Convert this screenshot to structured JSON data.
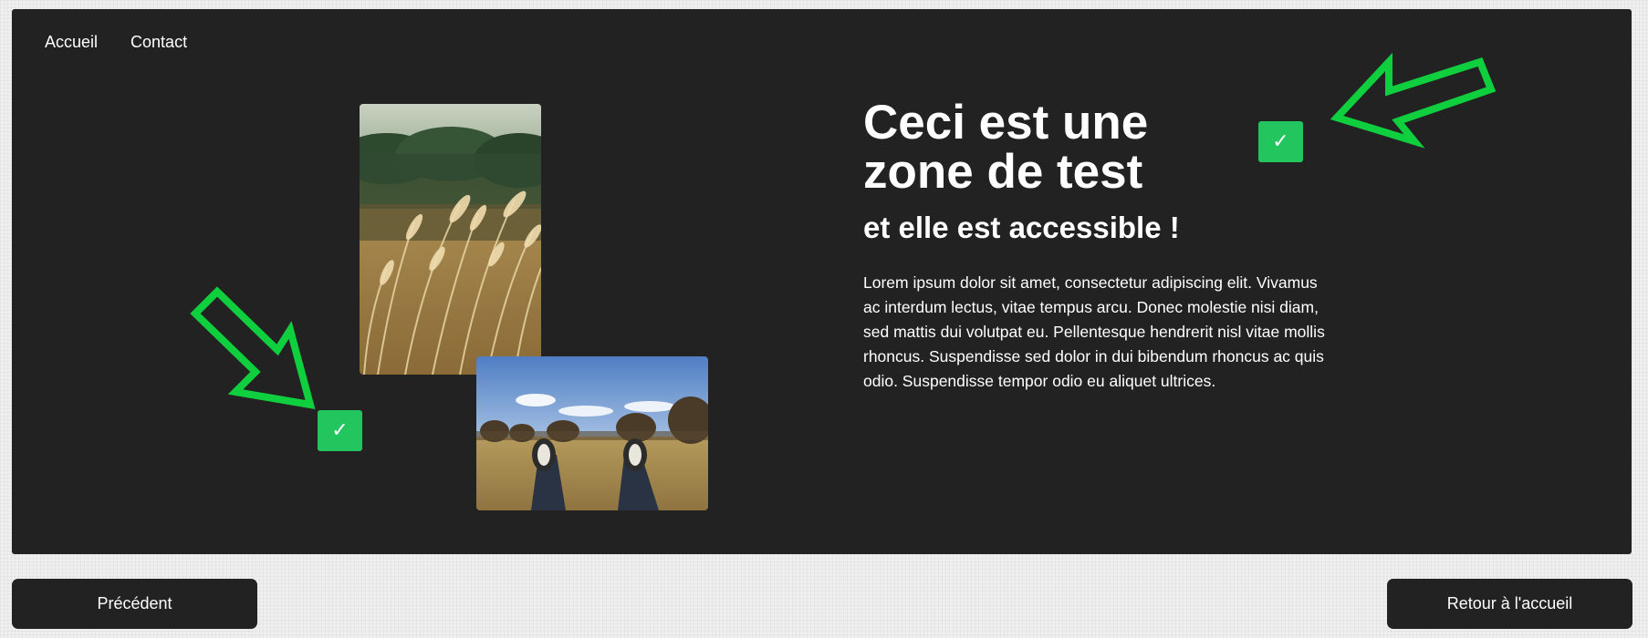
{
  "nav": {
    "items": [
      {
        "label": "Accueil"
      },
      {
        "label": "Contact"
      }
    ]
  },
  "hero": {
    "title": "Ceci est une zone de test",
    "subtitle": "et elle est accessible !",
    "body": "Lorem ipsum dolor sit amet, consectetur adipiscing elit. Vivamus ac interdum lectus, vitae tempus arcu. Donec molestie nisi diam, sed mattis dui volutpat eu. Pellentesque hendrerit nisl vitae mollis rhoncus. Suspendisse sed dolor in dui bibendum rhoncus ac quis odio. Suspendisse tempor odio eu aliquet ultrices."
  },
  "badges": {
    "check_symbol": "✓"
  },
  "icons": {
    "arrow_top": "arrow-pointing-left-icon",
    "arrow_bottom": "arrow-pointing-down-right-icon",
    "check": "checkmark-icon"
  },
  "footer": {
    "prev_label": "Précédent",
    "home_label": "Retour à l'accueil"
  },
  "colors": {
    "panel": "#222222",
    "accent_green": "#22c55e",
    "arrow_green": "#0fcf3f",
    "page_bg": "#efefef"
  }
}
